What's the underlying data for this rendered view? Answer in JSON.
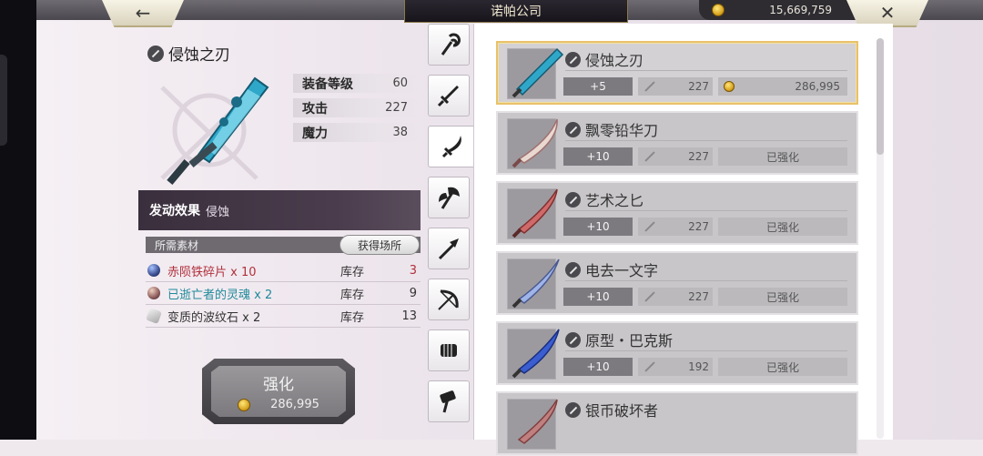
{
  "header": {
    "title": "诺帕公司",
    "gold": "15,669,759",
    "back_icon": "←",
    "close_icon": "✕"
  },
  "item": {
    "name": "侵蚀之刃",
    "stats": [
      {
        "label": "装备等级",
        "value": "60"
      },
      {
        "label": "攻击",
        "value": "227"
      },
      {
        "label": "魔力",
        "value": "38"
      }
    ],
    "effect_label": "发动效果",
    "effect_value": "侵蚀"
  },
  "materials": {
    "header": "所需素材",
    "source_button": "获得场所",
    "items": [
      {
        "name": "赤陨铁碎片 x 10",
        "stock_label": "库存",
        "count": "3",
        "color": "#b0303c"
      },
      {
        "name": "已逝亡者的灵魂 x 2",
        "stock_label": "库存",
        "count": "9",
        "color": "#1f8a9a"
      },
      {
        "name": "变质的波纹石 x 2",
        "stock_label": "库存",
        "count": "13",
        "color": "#333333"
      }
    ]
  },
  "enhance": {
    "label": "强化",
    "cost": "286,995"
  },
  "tabs": [
    "staff-icon",
    "sword-icon",
    "scimitar-icon",
    "axe-icon",
    "spear-icon",
    "bow-icon",
    "fist-icon",
    "hammer-icon"
  ],
  "weapons": [
    {
      "name": "侵蚀之刃",
      "level": "+5",
      "attack": "227",
      "price": "286,995",
      "status": "",
      "selected": true
    },
    {
      "name": "飘零铅华刀",
      "level": "+10",
      "attack": "227",
      "price": "",
      "status": "已强化",
      "selected": false
    },
    {
      "name": "艺术之匕",
      "level": "+10",
      "attack": "227",
      "price": "",
      "status": "已强化",
      "selected": false
    },
    {
      "name": "电去一文字",
      "level": "+10",
      "attack": "227",
      "price": "",
      "status": "已强化",
      "selected": false
    },
    {
      "name": "原型・巴克斯",
      "level": "+10",
      "attack": "192",
      "price": "",
      "status": "已强化",
      "selected": false
    },
    {
      "name": "银币破坏者",
      "level": "",
      "attack": "",
      "price": "",
      "status": "",
      "selected": false
    }
  ],
  "colors": {
    "accent_gold": "#e8c26a",
    "panel_dark": "#3a2f3d"
  }
}
